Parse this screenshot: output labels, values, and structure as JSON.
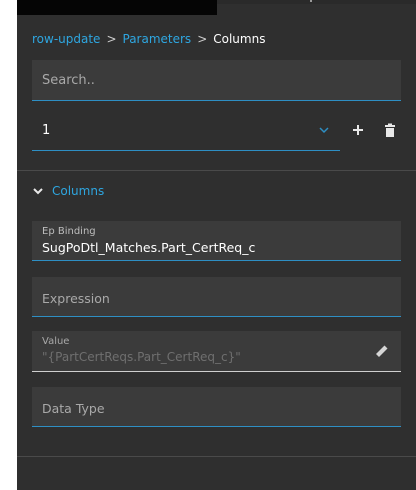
{
  "breadcrumb": {
    "item1": "row-update",
    "sep1": ">",
    "item2": "Parameters",
    "sep2": ">",
    "current": "Columns"
  },
  "search": {
    "placeholder": "Search.."
  },
  "selector": {
    "value": "1"
  },
  "section": {
    "title": "Columns"
  },
  "fields": {
    "ep_binding": {
      "label": "Ep Binding",
      "value": "SugPoDtl_Matches.Part_CertReq_c"
    },
    "expression": {
      "placeholder": "Expression"
    },
    "value": {
      "label": "Value",
      "value": "\"{PartCertReqs.Part_CertReq_c}\""
    },
    "data_type": {
      "placeholder": "Data Type"
    }
  },
  "icons": {
    "chevron": "chevron-down-icon",
    "add": "plus-icon",
    "delete": "trash-icon",
    "edit": "pencil-icon"
  },
  "colors": {
    "panel_bg": "#2f2f2f",
    "field_bg": "#3b3b3b",
    "accent": "#2ea6e0",
    "underline": "#2e8fc4"
  }
}
